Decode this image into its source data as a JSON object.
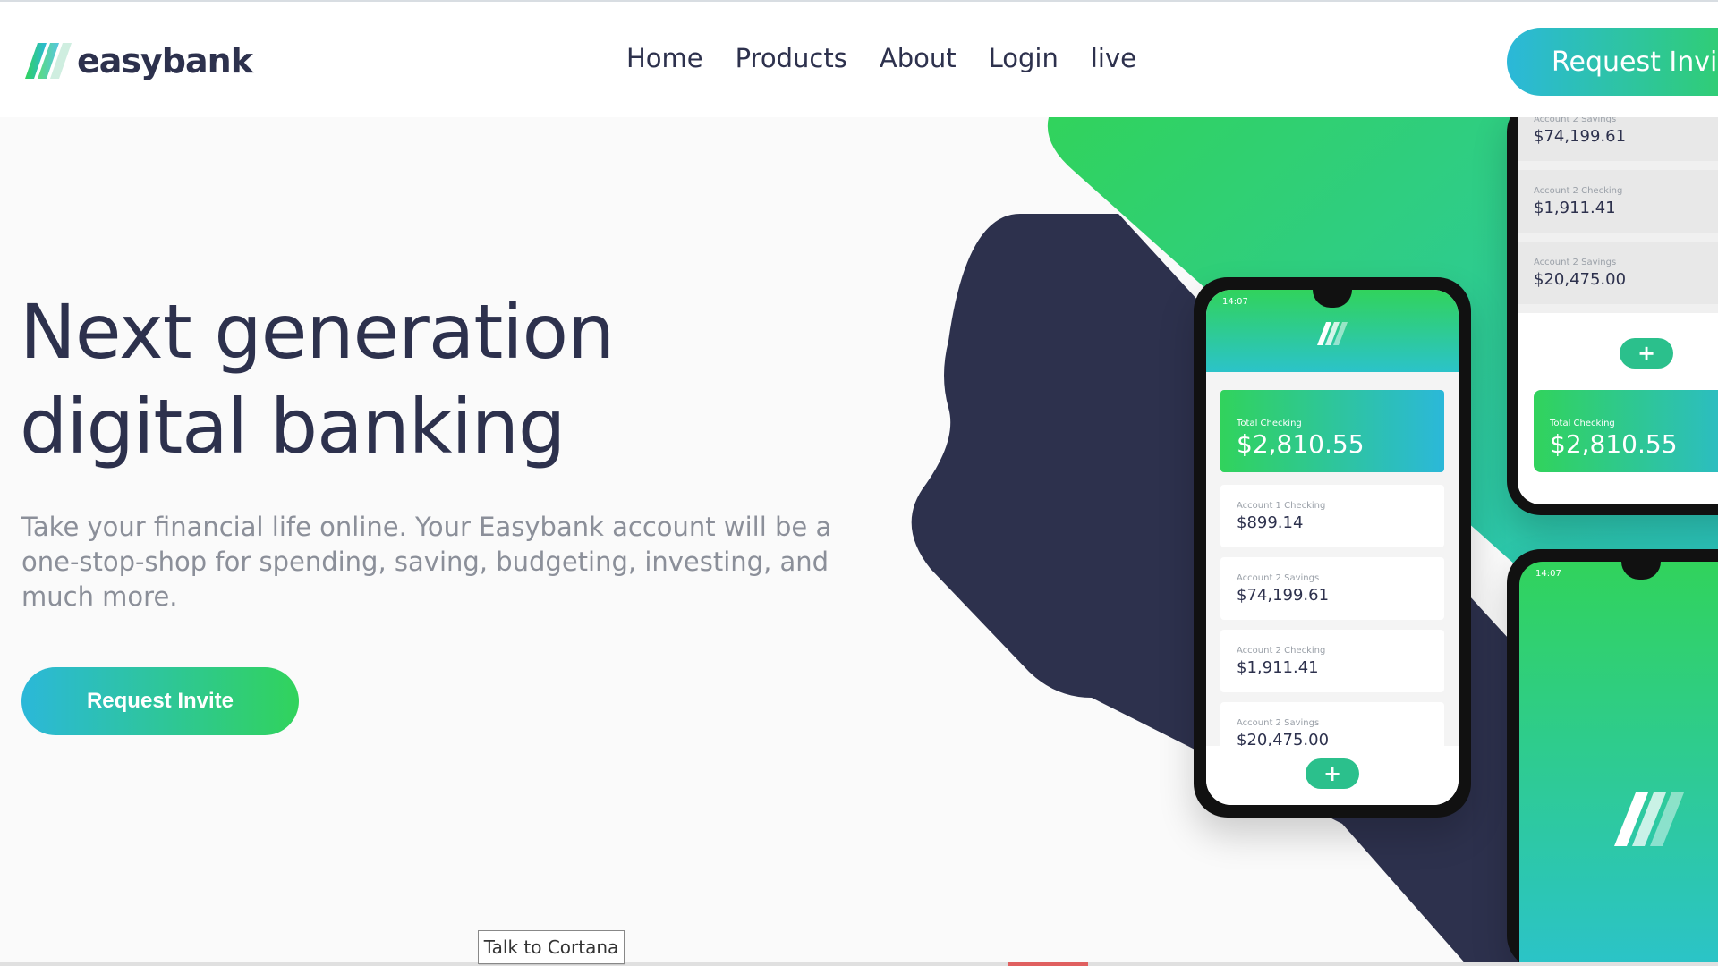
{
  "brand": {
    "name": "easybank"
  },
  "nav": {
    "items": [
      "Home",
      "Products",
      "About",
      "Login",
      "live"
    ]
  },
  "header": {
    "cta_label": "Request Invite"
  },
  "hero": {
    "title_line1": "Next generation",
    "title_line2": "digital banking",
    "text": "Take your financial life online. Your Easybank account will be a one-stop-shop for spending, saving, budgeting, investing, and much more.",
    "cta_label": "Request Invite"
  },
  "phone_main": {
    "time": "14:07",
    "total_label": "Total Checking",
    "total_amount": "$2,810.55",
    "accounts": [
      {
        "label": "Account 1 Checking",
        "amount": "$899.14"
      },
      {
        "label": "Account 2 Savings",
        "amount": "$74,199.61"
      },
      {
        "label": "Account 2 Checking",
        "amount": "$1,911.41"
      },
      {
        "label": "Account 2 Savings",
        "amount": "$20,475.00"
      }
    ],
    "fab": "+"
  },
  "phone_back": {
    "accounts": [
      {
        "label": "Account 2 Savings",
        "amount": "$74,199.61"
      },
      {
        "label": "Account 2 Checking",
        "amount": "$1,911.41"
      },
      {
        "label": "Account 2 Savings",
        "amount": "$20,475.00"
      }
    ],
    "total_label": "Total Checking",
    "total_amount": "$2,810.55",
    "fab": "+"
  },
  "phone_bottom": {
    "time": "14:07"
  },
  "taskbar": {
    "cortana_tooltip": "Talk to Cortana"
  },
  "colors": {
    "dark_blue": "#2d314d",
    "lime_green": "#31d35c",
    "bright_cyan": "#2bb8d9",
    "grayish_blue": "#8b8f99"
  },
  "icons": {
    "logo": "easybank-stripes-logo",
    "fab": "plus-icon"
  }
}
